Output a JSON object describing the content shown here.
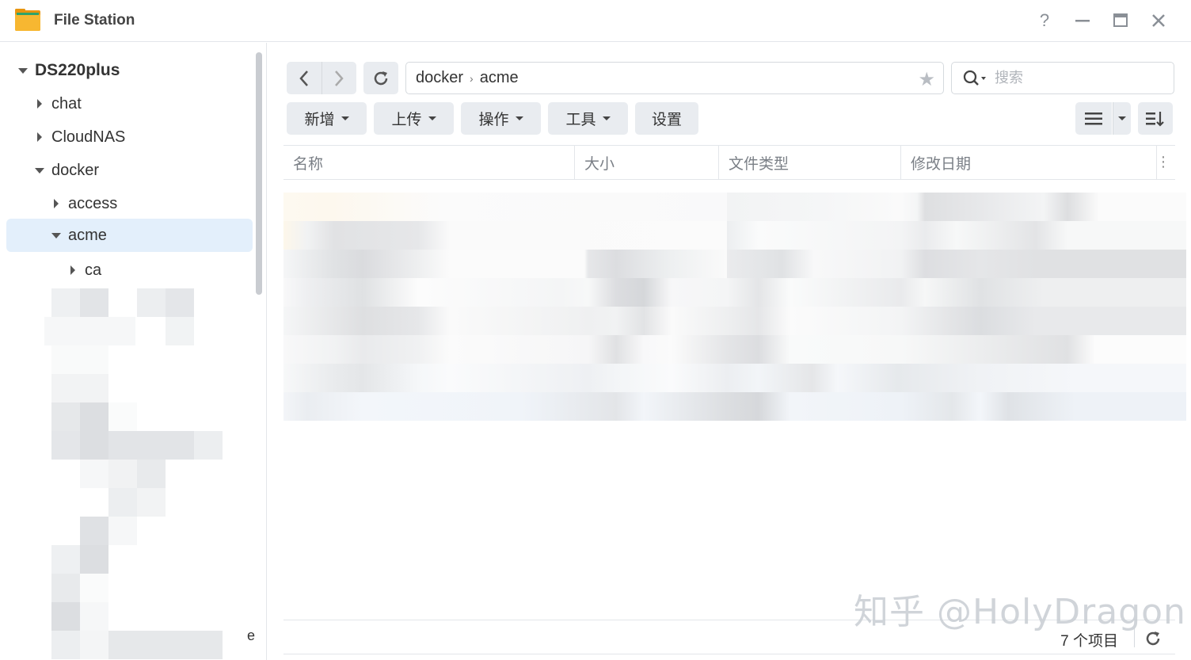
{
  "window": {
    "title": "File Station",
    "buttons": {
      "help": "?"
    }
  },
  "sidebar": {
    "root": "DS220plus",
    "items": [
      {
        "label": "chat",
        "expanded": false,
        "level": 1
      },
      {
        "label": "CloudNAS",
        "expanded": false,
        "level": 1
      },
      {
        "label": "docker",
        "expanded": true,
        "level": 1
      },
      {
        "label": "access",
        "expanded": false,
        "level": 2
      },
      {
        "label": "acme",
        "expanded": true,
        "level": 2,
        "selected": true
      },
      {
        "label": "ca",
        "expanded": false,
        "level": 3
      }
    ],
    "partial_text": "e"
  },
  "path": {
    "segments": [
      "docker",
      "acme"
    ]
  },
  "search": {
    "placeholder": "搜索"
  },
  "toolbar": {
    "create": "新增",
    "upload": "上传",
    "action": "操作",
    "tools": "工具",
    "settings": "设置"
  },
  "table": {
    "columns": [
      "名称",
      "大小",
      "文件类型",
      "修改日期"
    ]
  },
  "status": {
    "item_count": "7 个项目"
  },
  "watermark": "知乎 @HolyDragon",
  "colors": {
    "selected_bg": "#e3effb",
    "button_bg": "#e9ecf0",
    "border": "#e3e6ea",
    "folder_icon": "#f5a623"
  }
}
